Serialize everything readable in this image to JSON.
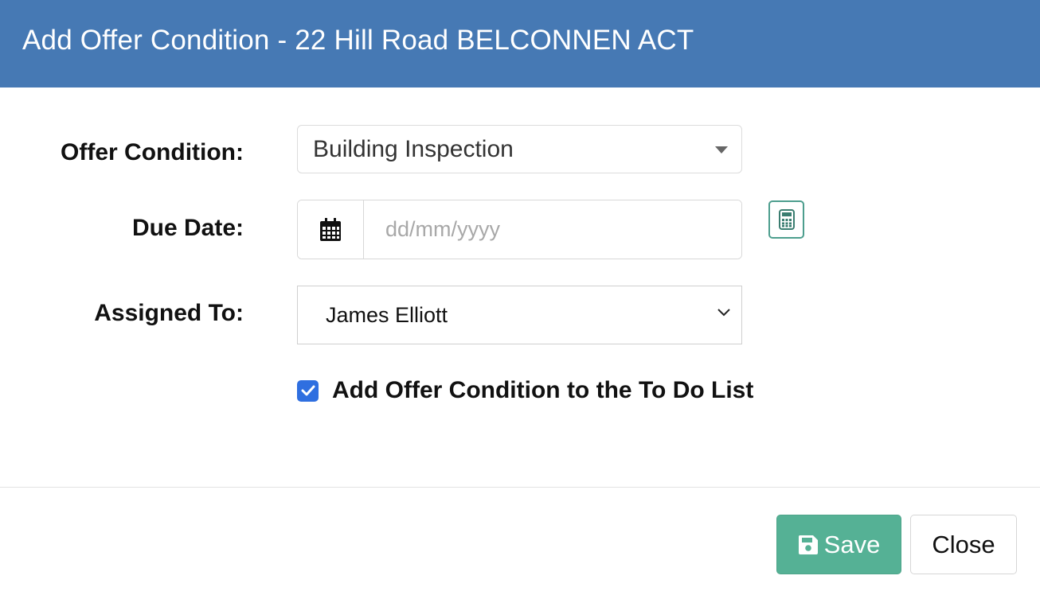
{
  "dialog": {
    "title": "Add Offer Condition - 22 Hill Road BELCONNEN ACT"
  },
  "form": {
    "offer_condition": {
      "label": "Offer Condition:",
      "value": "Building Inspection"
    },
    "due_date": {
      "label": "Due Date:",
      "placeholder": "dd/mm/yyyy",
      "icon": "calendar-icon",
      "action_icon": "calculator-icon"
    },
    "assigned_to": {
      "label": "Assigned To:",
      "value": "James Elliott"
    },
    "todo_checkbox": {
      "checked": true,
      "label_prefix": "Add Offer Condition to the ",
      "label_strong": "To Do List"
    }
  },
  "footer": {
    "save_label": "Save",
    "close_label": "Close"
  },
  "colors": {
    "header": "#4679b4",
    "save_button": "#55b195",
    "checkbox": "#2f6fe0",
    "calculator_border": "#4d9e8e"
  }
}
